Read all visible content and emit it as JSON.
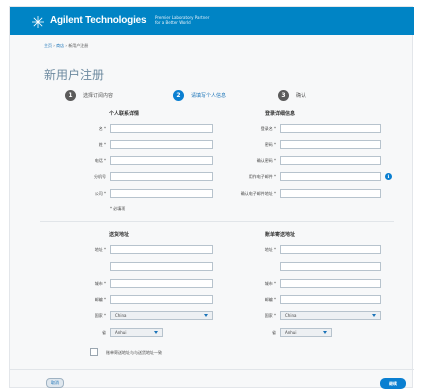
{
  "header": {
    "logo_text": "Agilent Technologies",
    "tagline_line1": "Premier Laboratory Partner",
    "tagline_line2": "for a Better World",
    "bg_color": "#0084c5"
  },
  "breadcrumb": {
    "home": "主页",
    "sep1": " › ",
    "store": "商店",
    "sep2": " › ",
    "current": "新用户注册"
  },
  "page_title": "新用户注册",
  "steps": [
    {
      "number": "1",
      "label": "选择订阅内容",
      "state": "done"
    },
    {
      "number": "2",
      "label": "请填写个人信息",
      "state": "active"
    },
    {
      "number": "3",
      "label": "确认",
      "state": "pending"
    }
  ],
  "personal": {
    "heading": "个人联系详情",
    "fields": [
      {
        "label": "名 *",
        "value": ""
      },
      {
        "label": "姓 *",
        "value": ""
      },
      {
        "label": "电话 *",
        "value": ""
      },
      {
        "label": "分机号",
        "value": ""
      },
      {
        "label": "公司 *",
        "value": ""
      }
    ],
    "required_note": "* 必填项"
  },
  "login": {
    "heading": "登录详细信息",
    "fields": [
      {
        "label": "登录名 *",
        "value": ""
      },
      {
        "label": "密码 *",
        "value": ""
      },
      {
        "label": "确认密码 *",
        "value": ""
      },
      {
        "label": "用作电子邮件 *",
        "value": ""
      },
      {
        "label": "确认电子邮件地址 *",
        "value": ""
      }
    ]
  },
  "shipping": {
    "heading": "送货地址",
    "address_label": "地址 *",
    "city_label": "城市 *",
    "postcode_label": "邮编 *",
    "country_label": "国家 *",
    "country_value": "China",
    "province_label": "省",
    "province_value": "Anhui"
  },
  "billing": {
    "heading": "账单寄送地址",
    "address_label": "地址 *",
    "city_label": "城市 *",
    "postcode_label": "邮编 *",
    "country_label": "国家 *",
    "country_value": "China",
    "province_label": "省",
    "province_value": "Anhui"
  },
  "same_address_label": "账单寄送地址与与送货地址一致",
  "buttons": {
    "cancel": "取消",
    "next": "继续"
  },
  "icons": {
    "logo": "agilent-spark-icon",
    "info": "info-icon",
    "dropdown": "chevron-down-icon"
  }
}
